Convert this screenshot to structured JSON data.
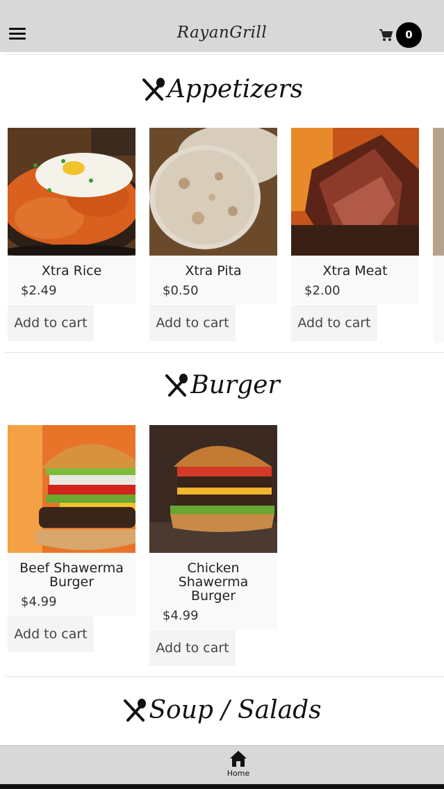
{
  "header": {
    "brand": "RayanGrill",
    "cart_count": "0",
    "menu_icon": "hamburger-icon",
    "cart_icon": "cart-icon"
  },
  "sections": [
    {
      "title": "Appetizers",
      "icon": "utensils-icon",
      "items": [
        {
          "name": "Xtra Rice",
          "price": "$2.49",
          "button": "Add to cart"
        },
        {
          "name": "Xtra Pita",
          "price": "$0.50",
          "button": "Add to cart"
        },
        {
          "name": "Xtra Meat",
          "price": "$2.00",
          "button": "Add to cart"
        }
      ]
    },
    {
      "title": "Burger",
      "icon": "utensils-icon",
      "items": [
        {
          "name": "Beef Shawerma Burger",
          "price": "$4.99",
          "button": "Add to cart"
        },
        {
          "name": "Chicken Shawerma Burger",
          "price": "$4.99",
          "button": "Add to cart"
        }
      ]
    },
    {
      "title": "Soup / Salads",
      "icon": "utensils-icon"
    }
  ],
  "bottom_nav": {
    "home_label": "Home",
    "home_icon": "home-icon"
  },
  "colors": {
    "bar_bg": "#d8d8d8",
    "card_bg": "#f9f9f9",
    "badge_bg": "#000000"
  }
}
